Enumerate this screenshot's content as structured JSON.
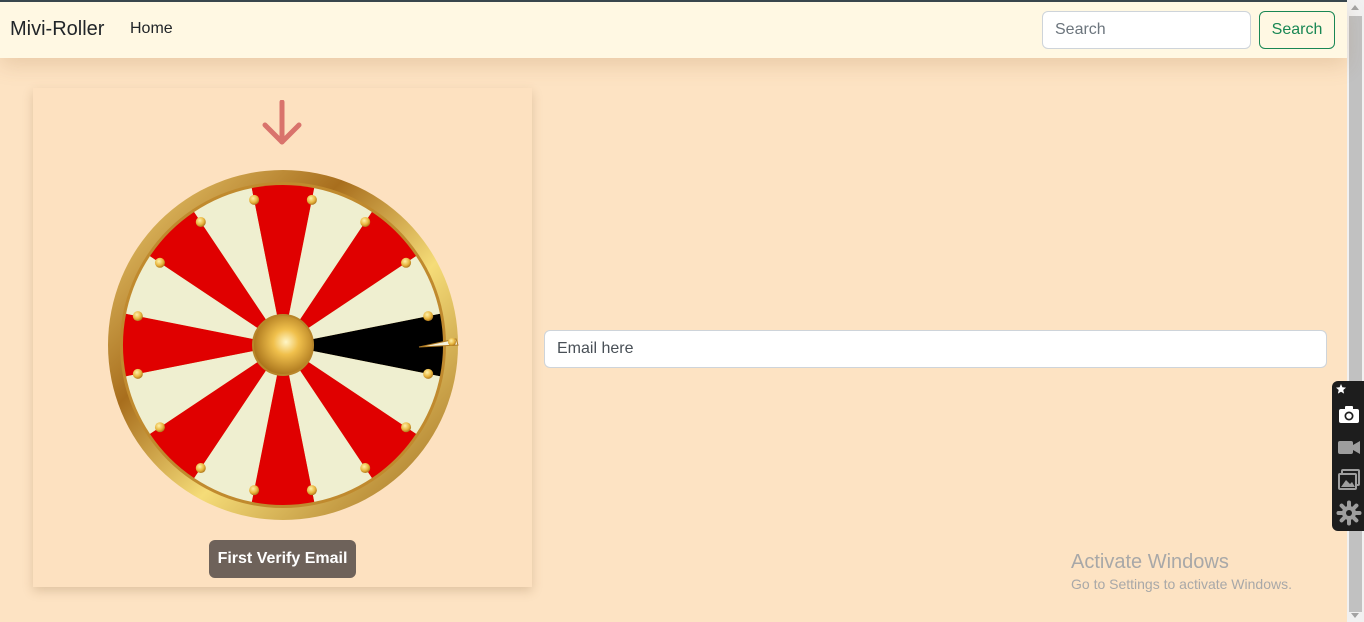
{
  "navbar": {
    "brand": "Mivi-Roller",
    "home_link": "Home",
    "search_placeholder": "Search",
    "search_button": "Search"
  },
  "spinner": {
    "arrow_icon": "arrow-down-icon",
    "segment_count": 16,
    "colors": {
      "red": "#e00000",
      "cream": "#efefd0",
      "highlight": "#000000",
      "gold": "#d4a13a",
      "arrow": "#d9736c"
    },
    "verify_button": "First Verify Email"
  },
  "email": {
    "placeholder": "Email here"
  },
  "watermark": {
    "title": "Activate Windows",
    "subtitle": "Go to Settings to activate Windows."
  },
  "capture_toolbar": {
    "icons": [
      "pin-icon",
      "camera-icon",
      "video-icon",
      "gallery-icon",
      "settings-icon"
    ]
  }
}
